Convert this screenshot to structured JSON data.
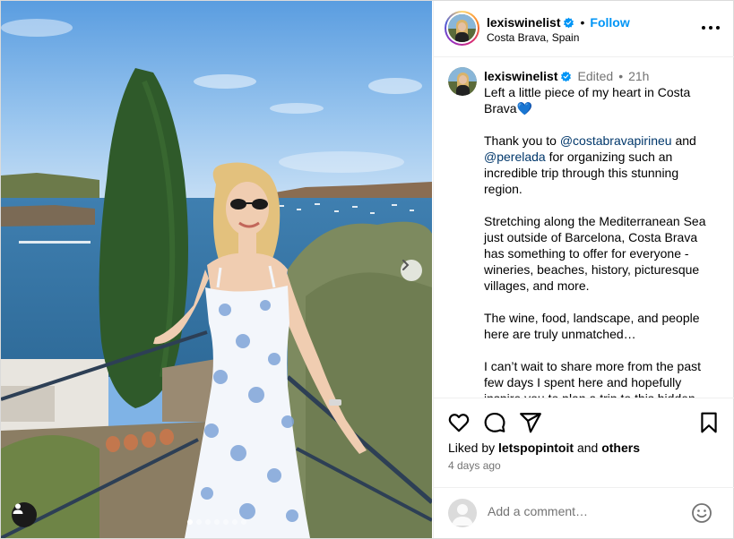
{
  "post": {
    "username": "lexiswinelist",
    "follow_label": "Follow",
    "separator": "•",
    "location": "Costa Brava, Spain"
  },
  "caption": {
    "username": "lexiswinelist",
    "edited": "Edited",
    "separator": "•",
    "age": "21h",
    "line1": "Left a little piece of my heart in Costa Brava💙",
    "p2_a": "Thank you to ",
    "mention1": "@costabravapirineu",
    "p2_b": " and ",
    "mention2": "@perelada",
    "p2_c": " for organizing such an incredible trip through this stunning region.",
    "p3": "Stretching along the Mediterranean Sea just outside of Barcelona, Costa Brava has something to offer for everyone - wineries, beaches, history, picturesque villages, and more.",
    "p4": "The wine, food, landscape, and people here are truly unmatched…",
    "p5": "I can’t wait to share more from the past few days I spent here and hopefully inspire you to plan a trip to this hidden gem."
  },
  "engagement": {
    "liked_by": "Liked by",
    "liker": "letspopintoit",
    "and": "and",
    "others": "others",
    "timestamp": "4 days ago"
  },
  "comment": {
    "placeholder": "Add a comment…"
  },
  "carousel": {
    "total_slides": 7,
    "current_slide": 1
  },
  "colors": {
    "accent": "#0095f6",
    "mention": "#00376b",
    "muted": "#737373",
    "verified": "#0095f6"
  }
}
